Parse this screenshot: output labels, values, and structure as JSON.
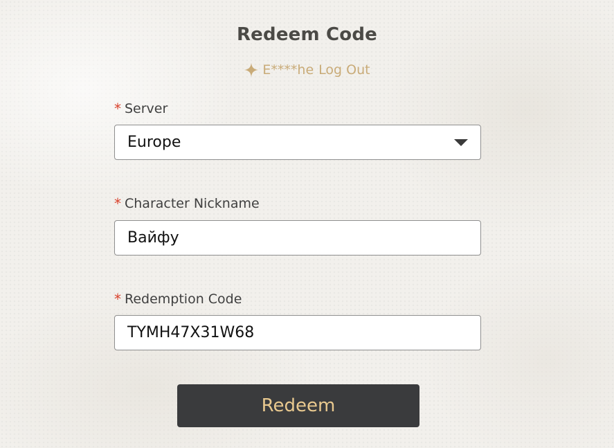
{
  "header": {
    "title": "Redeem Code",
    "account_email": "E****he",
    "logout_label": "Log Out"
  },
  "form": {
    "required_mark": "*",
    "server": {
      "label": "Server",
      "value": "Europe"
    },
    "nickname": {
      "label": "Character Nickname",
      "value": "Вайфу"
    },
    "code": {
      "label": "Redemption Code",
      "value": "TYMH47X31W68"
    },
    "submit_label": "Redeem"
  },
  "colors": {
    "accent_gold": "#c9ab78",
    "button_bg": "#3a3b3d",
    "button_text": "#e9c98f",
    "required": "#d9412b"
  },
  "icons": {
    "account": "sparkle-star-icon",
    "server_dropdown": "caret-down-icon"
  }
}
